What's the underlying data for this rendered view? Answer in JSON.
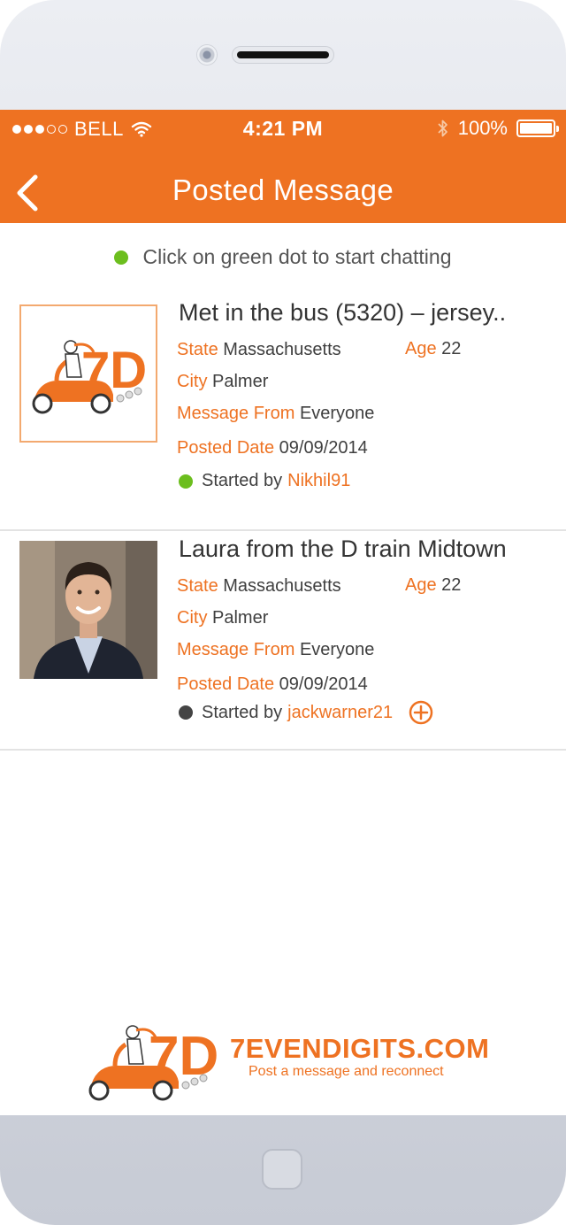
{
  "status_bar": {
    "carrier": "BELL",
    "signal_dots_full": 3,
    "signal_dots_total": 5,
    "time": "4:21 PM",
    "battery": "100%"
  },
  "nav": {
    "title": "Posted Message",
    "back_icon": "chevron-left-icon"
  },
  "hint": "Click on green dot to start chatting",
  "colors": {
    "accent": "#ee7222",
    "online": "#6cbe1e",
    "offline": "#444444"
  },
  "labels": {
    "state": "State",
    "age": "Age",
    "city": "City",
    "message_from": "Message From",
    "posted_date": "Posted Date",
    "started_by": "Started by"
  },
  "posts": [
    {
      "title": "Met in the bus (5320) – jersey..",
      "state": "Massachusetts",
      "age": "22",
      "city": "Palmer",
      "message_from": "Everyone",
      "posted_date": "09/09/2014",
      "started_by": "Nikhil91",
      "status": "online"
    },
    {
      "title": "Laura from the D train Midtown",
      "state": "Massachusetts",
      "age": "22",
      "city": "Palmer",
      "message_from": "Everyone",
      "posted_date": "09/09/2014",
      "started_by": "jackwarner21",
      "status": "offline"
    }
  ],
  "footer": {
    "brand": "7EVENDIGITS.COM",
    "tagline": "Post a message and reconnect"
  }
}
